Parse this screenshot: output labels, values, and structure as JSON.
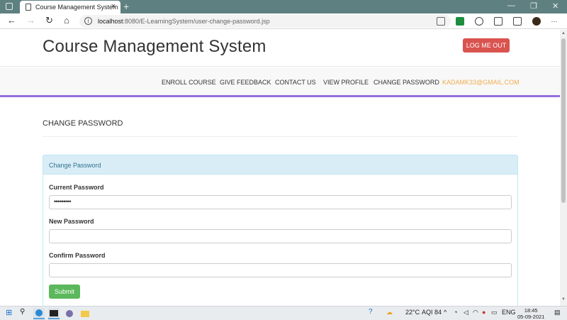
{
  "browser": {
    "tab_title": "Course Management System",
    "tab_close_glyph": "×",
    "new_tab_glyph": "+",
    "window_controls": [
      "—",
      "❐",
      "✕"
    ],
    "back_glyph": "←",
    "forward_glyph": "→",
    "reload_glyph": "↻",
    "home_glyph": "⌂",
    "url_host": "localhost",
    "url_path": ":8080/E-LearningSystem/user-change-password.jsp",
    "info_glyph": "i"
  },
  "site": {
    "title": "Course Management System",
    "logout_label": "LOG ME OUT",
    "nav": [
      "ENROLL COURSE",
      "GIVE FEEDBACK",
      "CONTACT US",
      "VIEW PROFILE",
      "CHANGE PASSWORD"
    ],
    "email": "KADAMK33@GMAIL.COM"
  },
  "main": {
    "heading": "CHANGE PASSWORD",
    "panel_title": "Change Password",
    "current_password_label": "Current Password",
    "current_password_value": "•••••••••",
    "new_password_label": "New Password",
    "new_password_value": "",
    "confirm_password_label": "Confirm Password",
    "confirm_password_value": "",
    "submit_label": "Submit"
  },
  "taskbar": {
    "weather": "22°C",
    "aqi": "AQI 84",
    "language": "ENG",
    "time": "18:45",
    "date": "05-09-2021"
  },
  "colors": {
    "titlebar": "#5f8080",
    "logout": "#d9534f",
    "nav_underline": "#9370db",
    "email": "#f0ad4e",
    "panel_heading": "#d9edf7",
    "submit": "#5cb85c"
  }
}
